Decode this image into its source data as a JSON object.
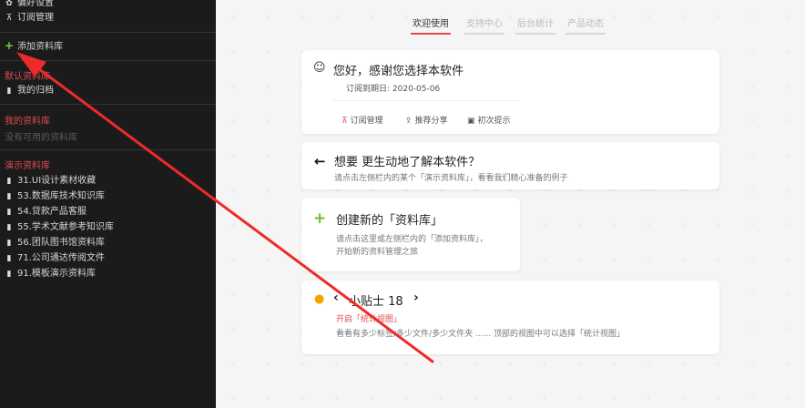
{
  "sidebar": {
    "items_top": [
      {
        "icon": "gear-icon",
        "label": "偏好设置"
      },
      {
        "icon": "cart-icon",
        "label": "订阅管理"
      }
    ],
    "add_library": {
      "icon": "plus-icon",
      "label": "添加资料库"
    },
    "default_head": "默认资料库",
    "default_items": [
      {
        "icon": "doc-icon",
        "label": "我的归档"
      }
    ],
    "my_head": "我的资料库",
    "my_empty": "没有可用的资料库",
    "demo_head": "演示资料库",
    "demo_items": [
      {
        "icon": "doc-icon",
        "label": "31.UI设计素材收藏"
      },
      {
        "icon": "doc-icon",
        "label": "53.数据库技术知识库"
      },
      {
        "icon": "doc-icon",
        "label": "54.贷款产品客服"
      },
      {
        "icon": "doc-icon",
        "label": "55.学术文献参考知识库"
      },
      {
        "icon": "doc-icon",
        "label": "56.团队图书馆资料库"
      },
      {
        "icon": "doc-icon",
        "label": "71.公司通达传阅文件"
      },
      {
        "icon": "doc-icon",
        "label": "91.模板演示资料库"
      }
    ]
  },
  "tabs": [
    "欢迎使用",
    "支持中心",
    "后台统计",
    "产品动态"
  ],
  "welcome": {
    "title": "您好，感谢您选择本软件",
    "expire": "订阅到期日: 2020-05-06",
    "links": [
      "订阅管理",
      "推荐分享",
      "初次提示"
    ]
  },
  "learn": {
    "title": "想要 更生动地了解本软件？",
    "desc": "请点击左侧栏内的某个「演示资料库」，看看我们精心准备的例子"
  },
  "create": {
    "title": "创建新的「资料库」",
    "desc1": "请点击这里或左侧栏内的「添加资料库」，",
    "desc2": "开始新的资料管理之旅"
  },
  "tip": {
    "title": "小贴士 18",
    "red": "开启「统计视图」",
    "desc": "看看有多少标签/多少文件/多少文件夹 ...... 顶部的视图中可以选择「统计视图」"
  }
}
